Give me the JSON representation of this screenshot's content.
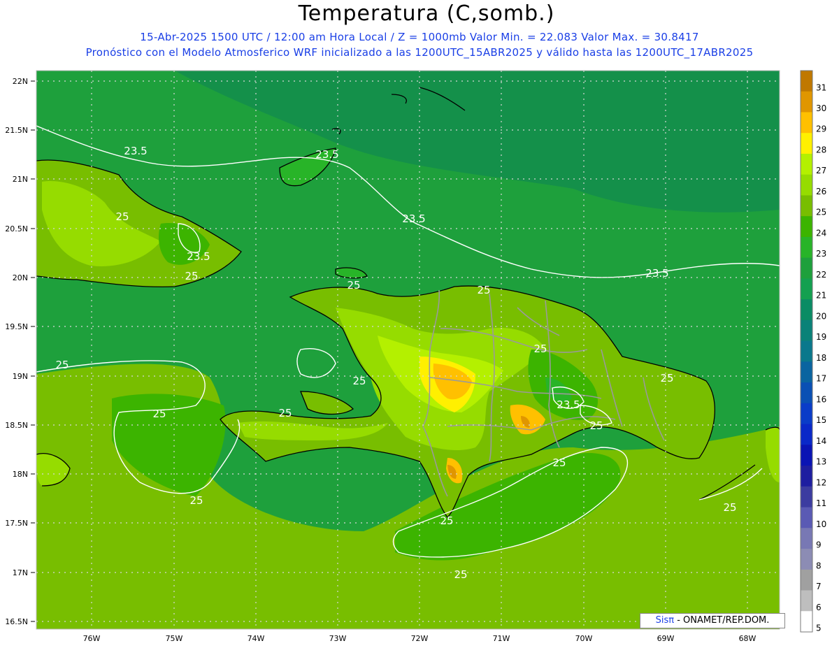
{
  "header": {
    "title": "Temperatura (C,somb.)",
    "subtitle1": "15-Abr-2025 1500 UTC / 12:00 am Hora Local / Z = 1000mb   Valor Min. = 22.083  Valor Max. = 30.8417",
    "subtitle2": "Pronóstico con el Modelo Atmosferico WRF inicializado a las 1200UTC_15ABR2025 y válido hasta las  1200UTC_17ABR2025"
  },
  "credit": {
    "brand": "Sis",
    "pi": "π",
    "rest": " - ONAMET/REP.DOM."
  },
  "axes": {
    "lat_labels": [
      "22N",
      "21.5N",
      "21N",
      "20.5N",
      "20N",
      "19.5N",
      "19N",
      "18.5N",
      "18N",
      "17.5N",
      "17N",
      "16.5N"
    ],
    "lon_labels": [
      "76W",
      "75W",
      "74W",
      "73W",
      "72W",
      "71W",
      "70W",
      "69W",
      "68W"
    ]
  },
  "legend": {
    "levels": [
      "31",
      "30",
      "29",
      "28",
      "27",
      "26",
      "25",
      "24",
      "23",
      "22",
      "21",
      "20",
      "19",
      "18",
      "17",
      "16",
      "15",
      "14",
      "13",
      "12",
      "11",
      "10",
      "9",
      "8",
      "7",
      "6",
      "5"
    ],
    "colors": [
      "#c07800",
      "#e09600",
      "#ffc000",
      "#fff000",
      "#b4f000",
      "#96dc00",
      "#78be00",
      "#3cb400",
      "#28b428",
      "#1ea03c",
      "#14a050",
      "#0a8c64",
      "#0a8278",
      "#0a788c",
      "#0a64a0",
      "#0a50b4",
      "#0a3cc8",
      "#0a28c8",
      "#0a14b4",
      "#1e1ea0",
      "#3c3ca0",
      "#5a5ab4",
      "#7878b4",
      "#8c8cb4",
      "#a0a0a0",
      "#bebebe",
      "#ffffff"
    ]
  },
  "contour_labels": [
    "23.5",
    "23.5",
    "23.5",
    "23.5",
    "23.5",
    "23.5",
    "25",
    "25",
    "25",
    "25",
    "25",
    "25",
    "25",
    "25",
    "25",
    "25",
    "25",
    "25",
    "25"
  ],
  "colors": {
    "sea": "#1ea03c",
    "sea_north": "#14904a",
    "land_low": "#78be00",
    "land_mid": "#96dc00",
    "hot": "#ffc000",
    "hottest": "#e09600",
    "subtitle": "#1a3fe6"
  }
}
